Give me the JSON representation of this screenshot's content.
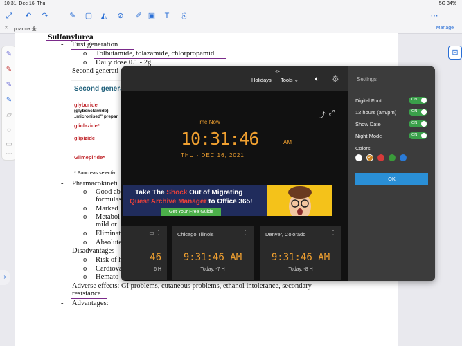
{
  "status": {
    "time": "10:31",
    "date": "Dec 16. Thu",
    "right": "5G 34%"
  },
  "tab": {
    "label": "pharma 全",
    "manage": "Manage"
  },
  "doc": {
    "heading": "Sulfonylurea",
    "l1": "First generation",
    "l1a": "Tolbutamide, tolazamide, chlorpropamid",
    "l1b": "Daily dose 0.1 - 2g",
    "l2": "Second generati",
    "card_title": "Second generat",
    "card_glyb": "glyburide",
    "card_glyb2": "(glybenclamide)",
    "card_micron": "„micronised\" prepar",
    "card_glic": "gliclazide*",
    "card_glip": "glipizide",
    "card_glim": "Glimepiride*",
    "card_note": "* Pancreas selectiv",
    "l3": "Pharmacokineti",
    "l3a": "Good ab",
    "l3a2": "formulas",
    "l3b": "Marked",
    "l3c": "Metabol",
    "l3c2": "mild or",
    "l3d": "Eliminat",
    "l3e": "Absolute",
    "l4": "Disadvantages",
    "l4a": "Risk of h",
    "l4b": "Cardiova",
    "l4c": "Hemato",
    "l5": "Adverse effects: GI problems, cutaneous problems, ethanol intolerance, secondary",
    "l5b": "resistance",
    "l6": "Advantages:"
  },
  "clock": {
    "nav_holidays": "Holidays",
    "nav_tools": "Tools",
    "nav_caret": "<>",
    "time_now_label": "Time Now",
    "time": "10:31:46",
    "ampm": "AM",
    "date": "THU - DEC 16, 2021"
  },
  "ad": {
    "line1a": "Take The ",
    "line1b": "Shock",
    "line1c": " Out of Migrating",
    "line2a": "Quest Archive Manager",
    "line2b": " to Office 365!",
    "cta": "Get Your Free Guide"
  },
  "world": [
    {
      "name": "",
      "time": "46",
      "off": "6 H"
    },
    {
      "name": "Chicago, Illinois",
      "time": "9:31:46 AM",
      "off": "Today, -7 H"
    },
    {
      "name": "Denver, Colorado",
      "time": "9:31:46 AM",
      "off": "Today, -8 H"
    }
  ],
  "settings": {
    "title": "Settings",
    "rows": [
      {
        "label": "Digital Font",
        "state": "ON"
      },
      {
        "label": "12 hours (am/pm)",
        "state": "ON"
      },
      {
        "label": "Show Date",
        "state": "ON"
      },
      {
        "label": "Night Mode",
        "state": "ON"
      }
    ],
    "colors_label": "Colors",
    "colors": [
      "#ffffff",
      "#c88020",
      "#d63a3a",
      "#3a9a3a",
      "#2a7ad6"
    ],
    "ok": "OK"
  },
  "colors": {
    "accent": "#2a6fd6",
    "clock": "#f0a030",
    "toggle": "#3aa04a"
  }
}
